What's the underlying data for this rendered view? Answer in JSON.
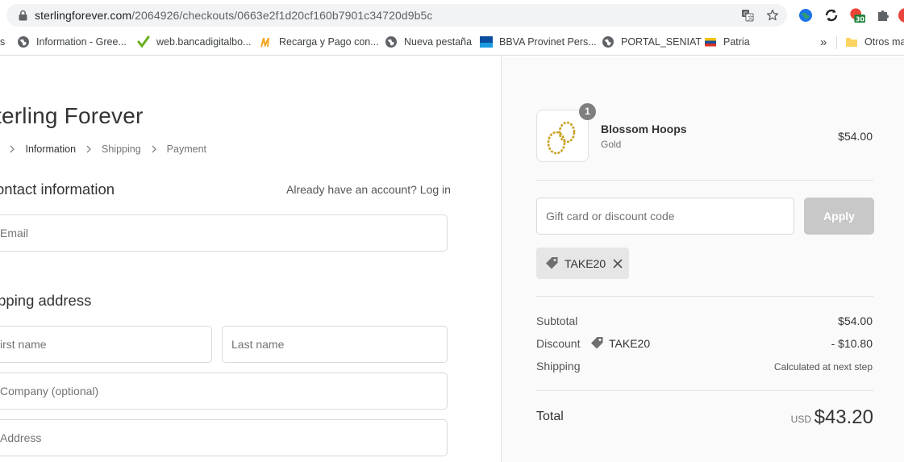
{
  "browser": {
    "url_host": "sterlingforever.com",
    "url_path": "/2064926/checkouts/0663e2f1d20cf160b7901c34720d9b5c",
    "extension_badge": "30",
    "bookmarks": [
      {
        "label": "s",
        "icon": "none"
      },
      {
        "label": "Information - Gree...",
        "icon": "globe-icon"
      },
      {
        "label": "web.bancadigitalbo...",
        "icon": "check-leaf-icon"
      },
      {
        "label": "Recarga y Pago con...",
        "icon": "m-logo-icon"
      },
      {
        "label": "Nueva pestaña",
        "icon": "globe-icon"
      },
      {
        "label": "BBVA Provinet Pers...",
        "icon": "bbva-icon"
      },
      {
        "label": "PORTAL_SENIAT",
        "icon": "globe-icon"
      },
      {
        "label": "Patria",
        "icon": "flag-icon"
      }
    ],
    "more_label": "»",
    "other_bookmarks": "Otros ma"
  },
  "checkout": {
    "store_name": "terling Forever",
    "breadcrumb": [
      {
        "label": "t",
        "current": false
      },
      {
        "label": "Information",
        "current": true
      },
      {
        "label": "Shipping",
        "current": false
      },
      {
        "label": "Payment",
        "current": false
      }
    ],
    "contact_title": "ontact information",
    "login_prompt": "Already have an account?",
    "login_link": "Log in",
    "email_placeholder": "Email",
    "shipping_title": "ipping address",
    "first_name_placeholder": "irst name",
    "last_name_placeholder": "Last name",
    "company_placeholder": "Company (optional)",
    "address_placeholder": "Address"
  },
  "summary": {
    "product": {
      "name": "Blossom Hoops",
      "variant": "Gold",
      "price": "$54.00",
      "quantity": "1"
    },
    "discount_placeholder": "Gift card or discount code",
    "apply_label": "Apply",
    "applied_code": "TAKE20",
    "subtotal_label": "Subtotal",
    "subtotal_value": "$54.00",
    "discount_label": "Discount",
    "discount_code": "TAKE20",
    "discount_value": "- $10.80",
    "shipping_label": "Shipping",
    "shipping_value": "Calculated at next step",
    "total_label": "Total",
    "currency": "USD",
    "total_value": "$43.20"
  },
  "colors": {
    "apply_disabled": "#c8c8c8",
    "sidebar_bg": "#fafafa",
    "chip_bg": "#e6e6e6",
    "gold": "#c9a227"
  }
}
